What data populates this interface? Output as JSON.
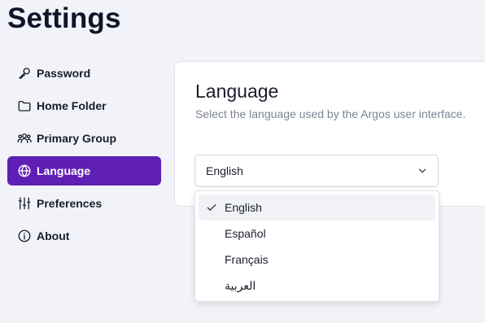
{
  "page": {
    "title": "Settings"
  },
  "sidebar": {
    "items": [
      {
        "label": "Password",
        "icon": "key-icon",
        "active": false
      },
      {
        "label": "Home Folder",
        "icon": "folder-icon",
        "active": false
      },
      {
        "label": "Primary Group",
        "icon": "users-icon",
        "active": false
      },
      {
        "label": "Language",
        "icon": "globe-icon",
        "active": true
      },
      {
        "label": "Preferences",
        "icon": "sliders-icon",
        "active": false
      },
      {
        "label": "About",
        "icon": "info-icon",
        "active": false
      }
    ]
  },
  "language_panel": {
    "title": "Language",
    "description": "Select the language used by the Argos user interface.",
    "select": {
      "value": "English",
      "icon": "chevron-down-icon"
    },
    "options": [
      {
        "label": "English",
        "selected": true
      },
      {
        "label": "Español",
        "selected": false
      },
      {
        "label": "Français",
        "selected": false
      },
      {
        "label": "العربية",
        "selected": false
      }
    ]
  },
  "colors": {
    "accent": "#5f1fb5",
    "background": "#f1f3f8",
    "card": "#ffffff",
    "muted_text": "#7b8494"
  }
}
